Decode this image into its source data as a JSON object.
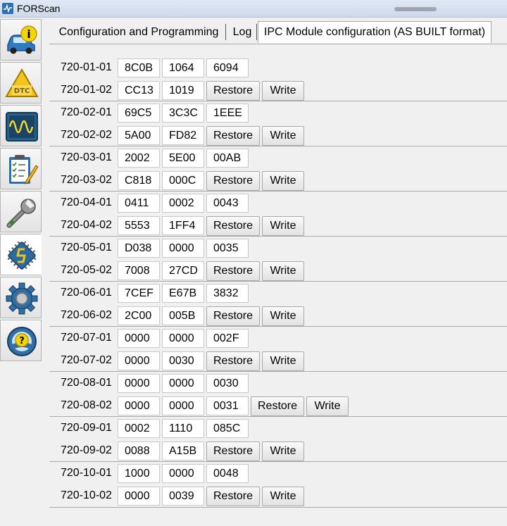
{
  "window": {
    "title": "FORScan"
  },
  "tabs": [
    {
      "label": "Configuration and Programming"
    },
    {
      "label": "Log"
    },
    {
      "label": "IPC Module configuration (AS BUILT format)"
    }
  ],
  "sidebar": [
    {
      "icon": "vehicle-info-icon"
    },
    {
      "icon": "dtc-icon"
    },
    {
      "icon": "oscilloscope-icon"
    },
    {
      "icon": "checklist-icon"
    },
    {
      "icon": "wrench-icon"
    },
    {
      "icon": "chip-icon"
    },
    {
      "icon": "gear-icon"
    },
    {
      "icon": "help-steering-icon"
    }
  ],
  "buttons": {
    "restore": "Restore",
    "write": "Write"
  },
  "rows": [
    {
      "label": "720-01-01",
      "values": [
        "8C0B",
        "1064",
        "6094"
      ]
    },
    {
      "label": "720-01-02",
      "values": [
        "CC13",
        "1019"
      ]
    },
    {
      "label": "720-02-01",
      "values": [
        "69C5",
        "3C3C",
        "1EEE"
      ]
    },
    {
      "label": "720-02-02",
      "values": [
        "5A00",
        "FD82"
      ]
    },
    {
      "label": "720-03-01",
      "values": [
        "2002",
        "5E00",
        "00AB"
      ]
    },
    {
      "label": "720-03-02",
      "values": [
        "C818",
        "000C"
      ]
    },
    {
      "label": "720-04-01",
      "values": [
        "0411",
        "0002",
        "0043"
      ]
    },
    {
      "label": "720-04-02",
      "values": [
        "5553",
        "1FF4"
      ]
    },
    {
      "label": "720-05-01",
      "values": [
        "D038",
        "0000",
        "0035"
      ]
    },
    {
      "label": "720-05-02",
      "values": [
        "7008",
        "27CD"
      ]
    },
    {
      "label": "720-06-01",
      "values": [
        "7CEF",
        "E67B",
        "3832"
      ]
    },
    {
      "label": "720-06-02",
      "values": [
        "2C00",
        "005B"
      ]
    },
    {
      "label": "720-07-01",
      "values": [
        "0000",
        "0000",
        "002F"
      ]
    },
    {
      "label": "720-07-02",
      "values": [
        "0000",
        "0030"
      ]
    },
    {
      "label": "720-08-01",
      "values": [
        "0000",
        "0000",
        "0030"
      ]
    },
    {
      "label": "720-08-02",
      "values": [
        "0000",
        "0000",
        "0031"
      ]
    },
    {
      "label": "720-09-01",
      "values": [
        "0002",
        "1110",
        "085C"
      ]
    },
    {
      "label": "720-09-02",
      "values": [
        "0088",
        "A15B"
      ]
    },
    {
      "label": "720-10-01",
      "values": [
        "1000",
        "0000",
        "0048"
      ]
    },
    {
      "label": "720-10-02",
      "values": [
        "0000",
        "0039"
      ]
    }
  ]
}
